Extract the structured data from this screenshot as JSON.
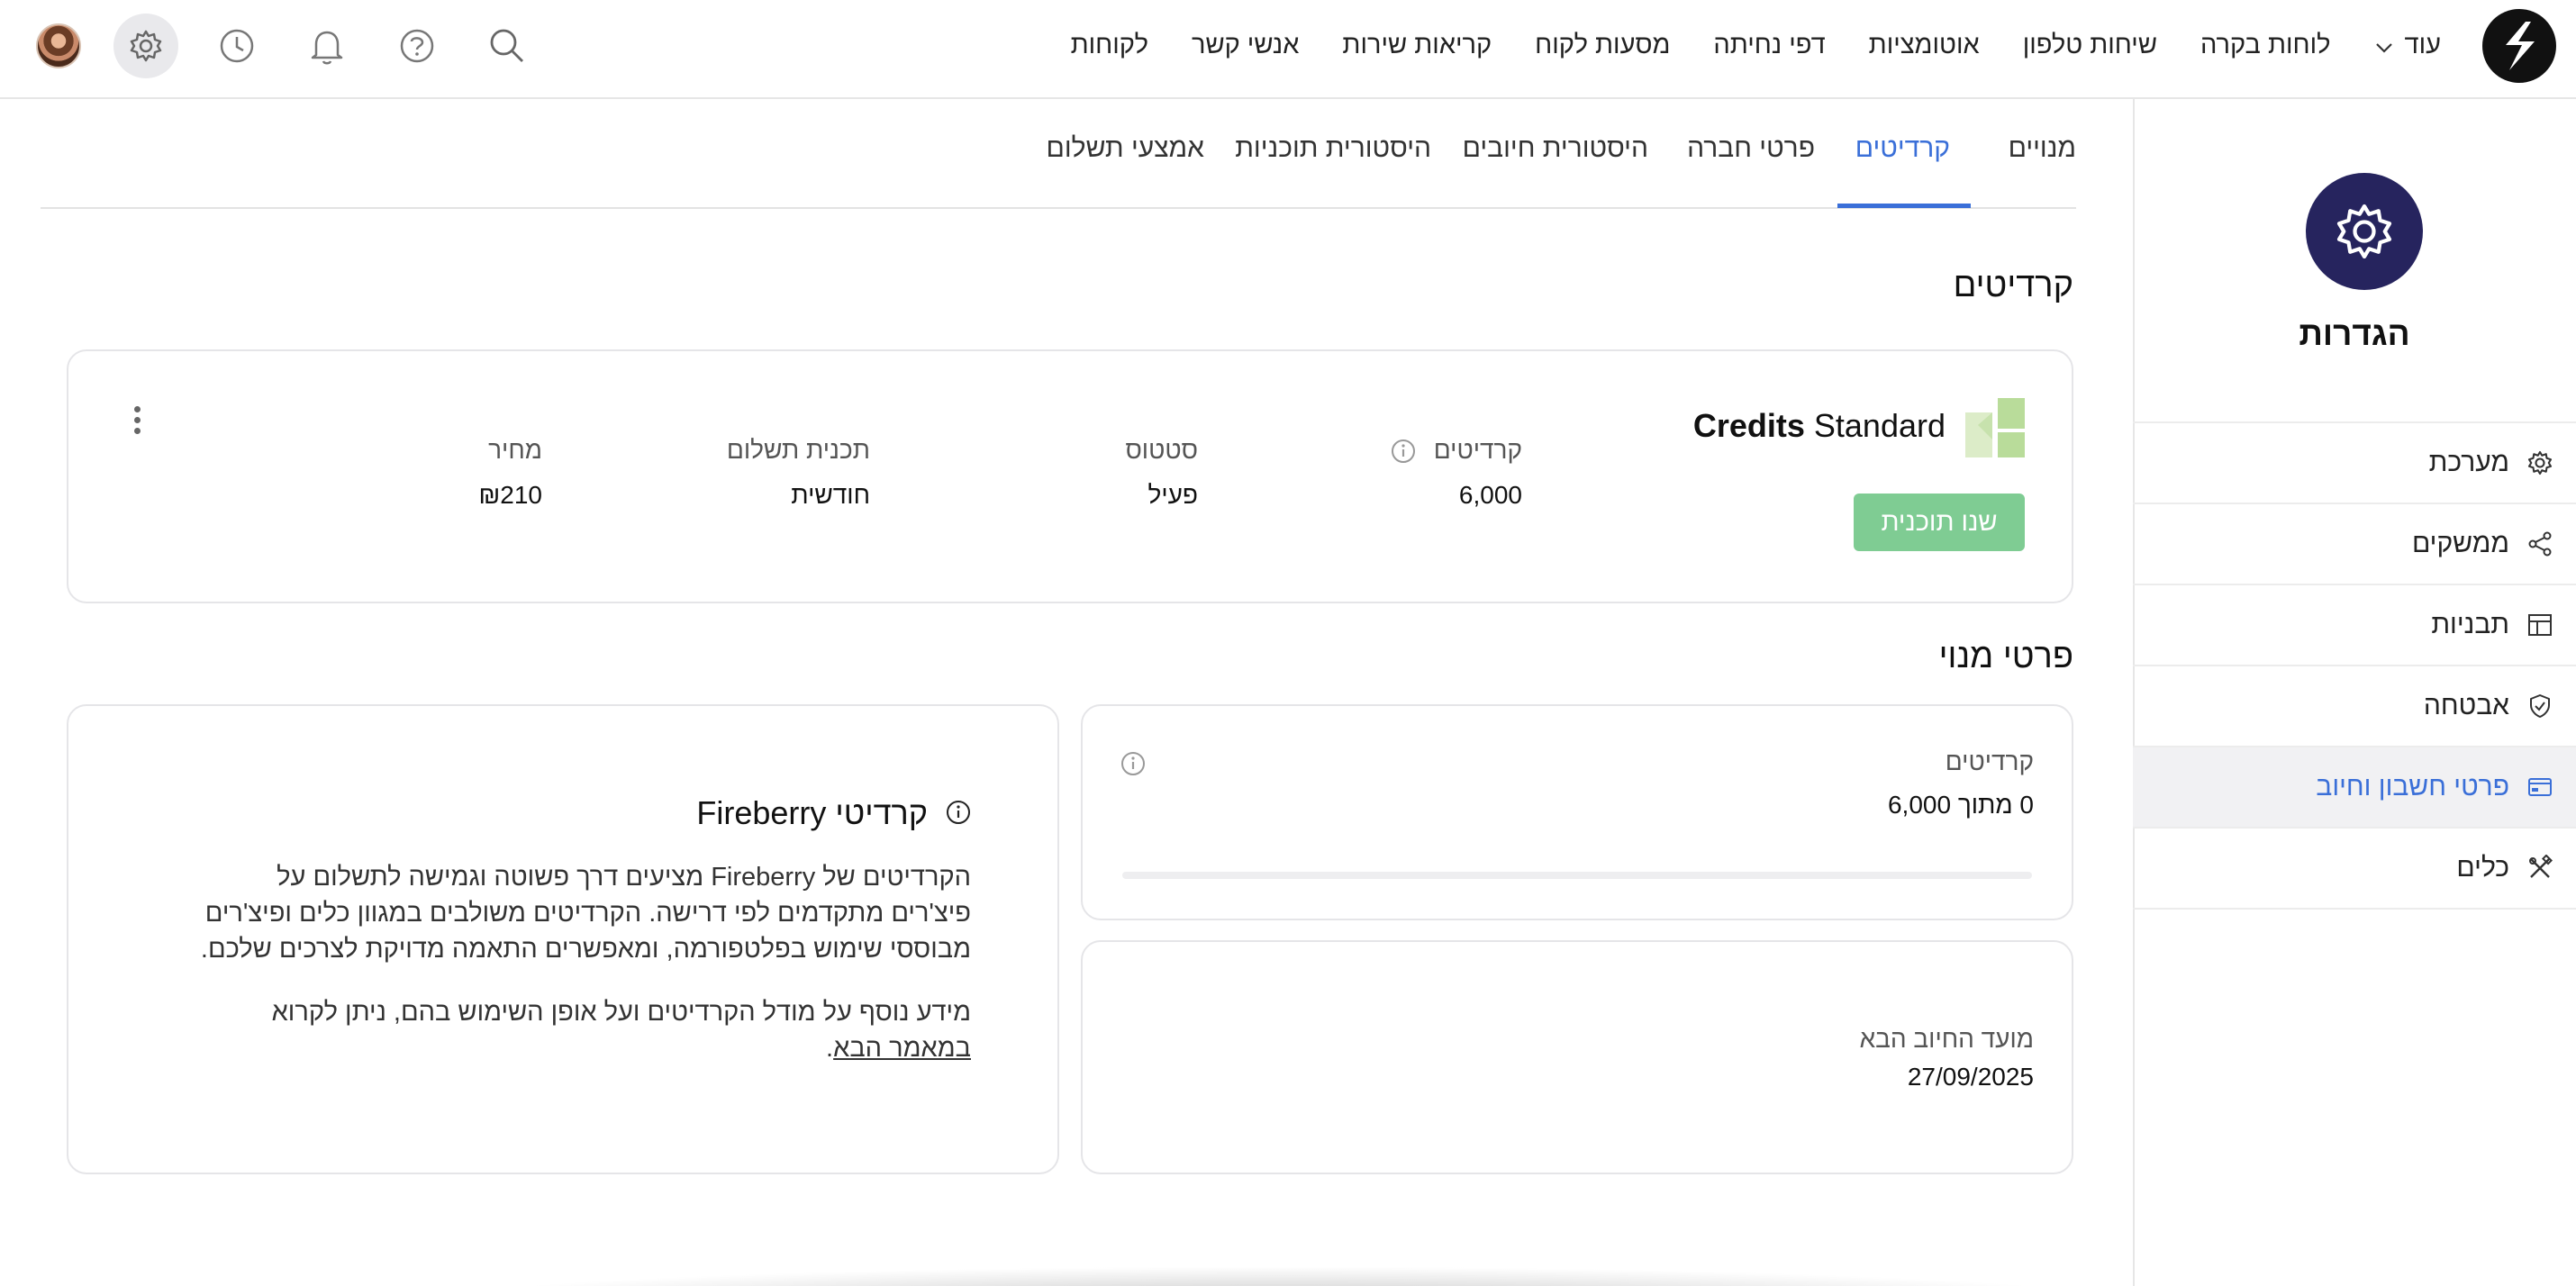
{
  "topnav": {
    "items": [
      "לקוחות",
      "אנשי קשר",
      "קריאות שירות",
      "מסעות לקוח",
      "דפי נחיתה",
      "אוטומציות",
      "שיחות טלפון",
      "לוחות בקרה"
    ],
    "more_label": "עוד",
    "icons": [
      "search-icon",
      "help-icon",
      "bell-icon",
      "history-icon",
      "settings-icon",
      "avatar"
    ]
  },
  "sidebar": {
    "title": "הגדרות",
    "items": [
      {
        "label": "מערכת",
        "icon": "gear-icon"
      },
      {
        "label": "ממשקים",
        "icon": "share-icon"
      },
      {
        "label": "תבניות",
        "icon": "layout-icon"
      },
      {
        "label": "אבטחה",
        "icon": "shield-icon"
      },
      {
        "label": "פרטי חשבון וחיוב",
        "icon": "billing-card-icon",
        "active": true
      },
      {
        "label": "כלים",
        "icon": "tools-icon"
      }
    ]
  },
  "tabs": {
    "items": [
      "מנויים",
      "קרדיטים",
      "פרטי חברה",
      "היסטורית חיובים",
      "היסטורית תוכניות",
      "אמצעי תשלום"
    ],
    "active": "קרדיטים"
  },
  "credits_section": {
    "title": "קרדיטים",
    "plan": {
      "name_regular": "Standard",
      "name_bold": "Credits",
      "button_label": "שנו תוכנית",
      "columns": [
        {
          "label": "קרדיטים",
          "value": "6,000"
        },
        {
          "label": "סטטוס",
          "value": "פעיל"
        },
        {
          "label": "תכנית תשלום",
          "value": "חודשית"
        },
        {
          "label": "מחיר",
          "value": "₪210"
        }
      ]
    }
  },
  "subscription_section": {
    "title": "פרטי מנוי",
    "usage": {
      "label": "קרדיטים",
      "value": "0 מתוך 6,000",
      "progress": 0
    },
    "next_billing": {
      "label": "מועד החיוב הבא",
      "value": "27/09/2025"
    },
    "info": {
      "title": "קרדיטי Fireberry",
      "paragraph1": "הקרדיטים של Fireberry מציעים דרך פשוטה וגמישה לתשלום על פיצ'רים מתקדמים לפי דרישה. הקרדיטים משולבים במגוון כלים ופיצ'רים מבוססי שימוש בפלטפורמה, ומאפשרים התאמה מדויקת לצרכים שלכם.",
      "paragraph2_text": "מידע נוסף על מודל הקרדיטים ועל אופן השימוש בהם, ניתן לקרוא",
      "paragraph2_link": "במאמר הבא",
      "paragraph2_end": "."
    }
  },
  "colors": {
    "accent": "#3a6fd8",
    "brand_dark": "#26245e",
    "button_green": "#7fcc93",
    "plan_icon_green": "#b9dc9a"
  }
}
